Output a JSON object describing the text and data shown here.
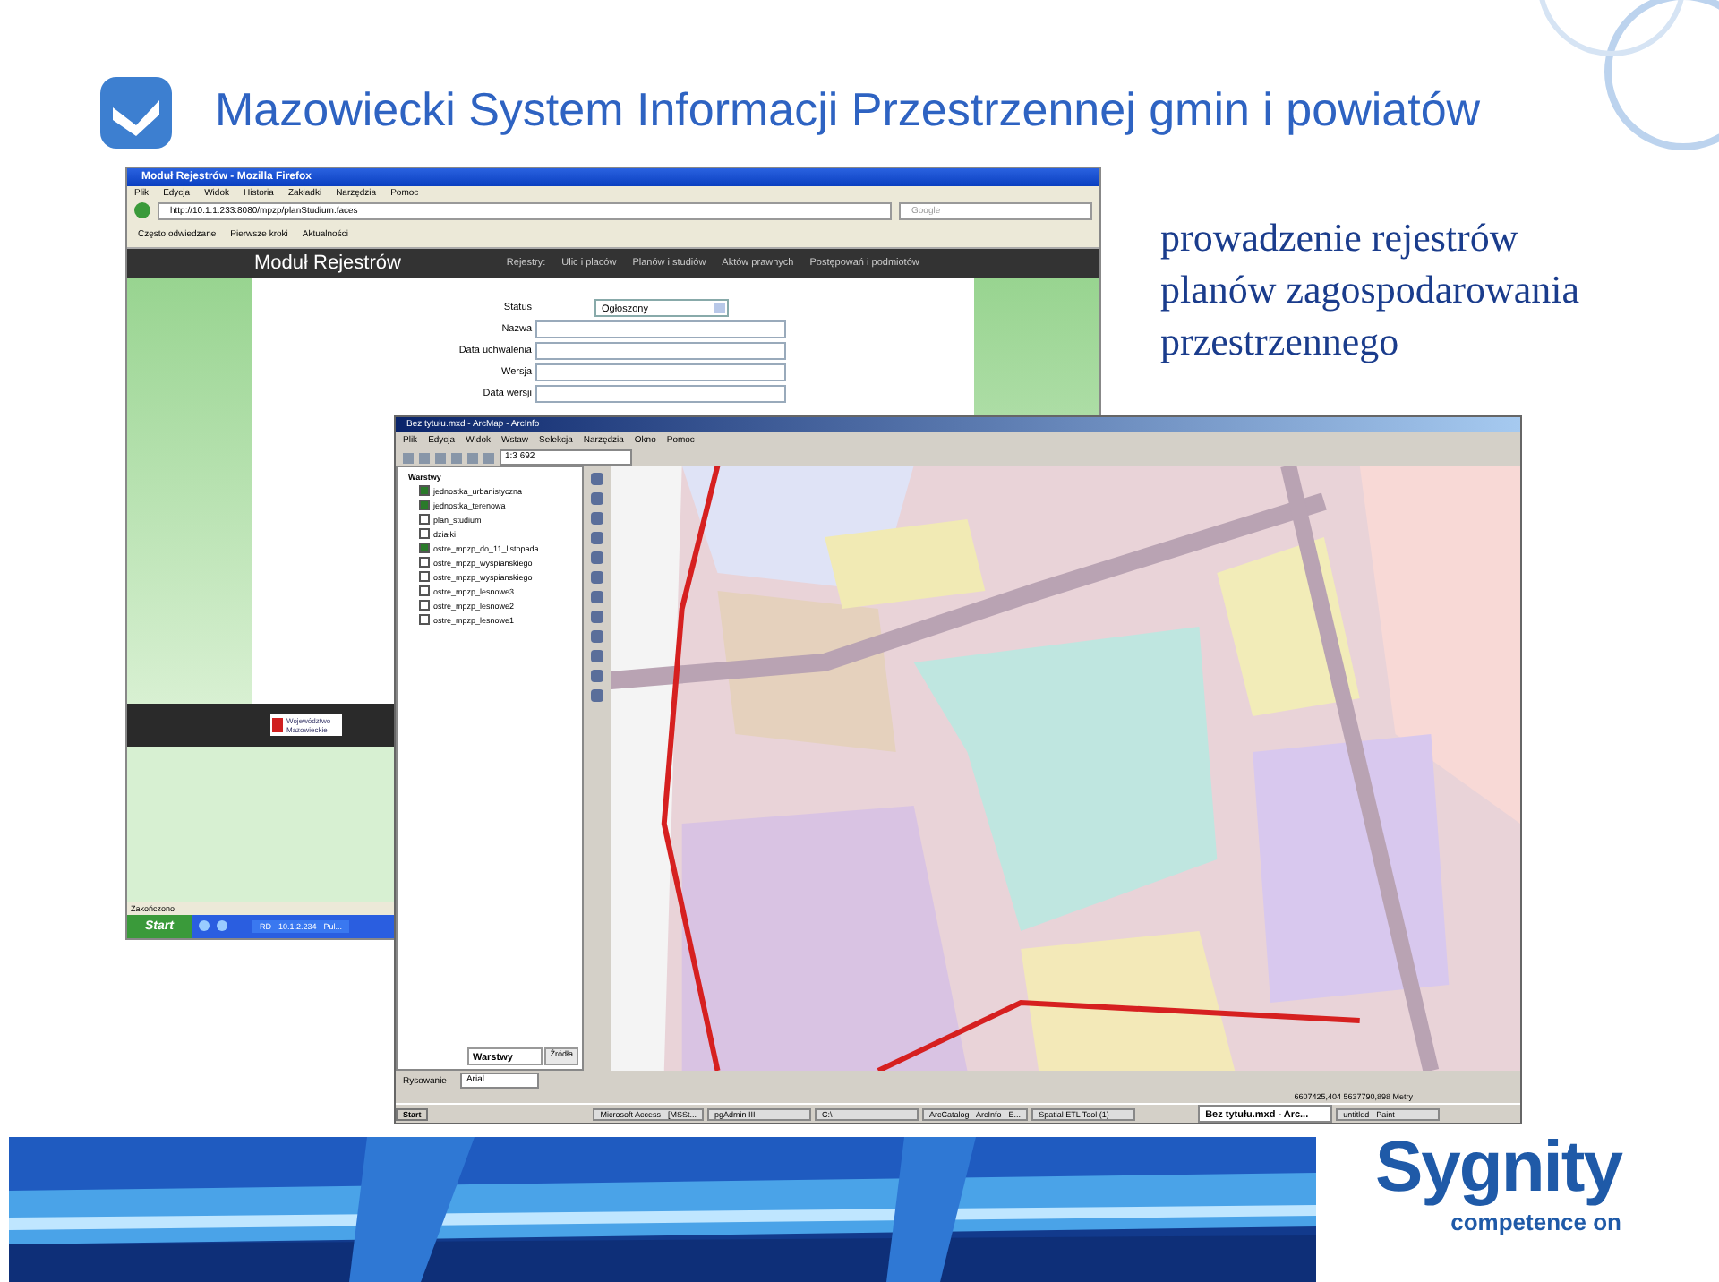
{
  "slide": {
    "title": "Mazowiecki System Informacji Przestrzennej gmin i powiatów",
    "caption_lines": [
      "prowadzenie rejestrów",
      "planów zagospodarowania",
      "przestrzennego"
    ],
    "brand": "Sygnity",
    "tagline": "competence on"
  },
  "browser": {
    "title": "Moduł Rejestrów - Mozilla Firefox",
    "menu": [
      "Plik",
      "Edycja",
      "Widok",
      "Historia",
      "Zakładki",
      "Narzędzia",
      "Pomoc"
    ],
    "url": "http://10.1.1.233:8080/mpzp/planStudium.faces",
    "search_placeholder": "Google",
    "bookmarks": [
      "Często odwiedzane",
      "Pierwsze kroki",
      "Aktualności"
    ],
    "header": {
      "brand": "Moduł Rejestrów",
      "nav_label": "Rejestry:",
      "nav": [
        "Ulic i placów",
        "Planów i studiów",
        "Aktów prawnych",
        "Postępowań i podmiotów"
      ]
    },
    "form": [
      {
        "label": "Status",
        "kind": "select",
        "value": "Ogłoszony"
      },
      {
        "label": "Nazwa",
        "kind": "text"
      },
      {
        "label": "Data uchwalenia",
        "kind": "text"
      },
      {
        "label": "Wersja",
        "kind": "text"
      },
      {
        "label": "Data wersji",
        "kind": "text"
      }
    ],
    "footer_logo": "Województwo Mazowieckie",
    "status": "Zakończono",
    "start": "Start",
    "task": "RD - 10.1.2.234 - Pul..."
  },
  "arcmap": {
    "title": "Bez tytułu.mxd - ArcMap - ArcInfo",
    "menu": [
      "Plik",
      "Edycja",
      "Widok",
      "Wstaw",
      "Selekcja",
      "Narzędzia",
      "Okno",
      "Pomoc"
    ],
    "scale": "1:3 692",
    "toc_root": "Warstwy",
    "layers": [
      {
        "name": "jednostka_urbanistyczna",
        "checked": true
      },
      {
        "name": "jednostka_terenowa",
        "checked": true
      },
      {
        "name": "plan_studium",
        "checked": false
      },
      {
        "name": "działki",
        "checked": false
      },
      {
        "name": "ostre_mpzp_do_11_listopada",
        "checked": true
      },
      {
        "name": "ostre_mpzp_wyspianskiego",
        "checked": false
      },
      {
        "name": "ostre_mpzp_wyspianskiego",
        "checked": false
      },
      {
        "name": "ostre_mpzp_lesnowe3",
        "checked": false
      },
      {
        "name": "ostre_mpzp_lesnowe2",
        "checked": false
      },
      {
        "name": "ostre_mpzp_lesnowe1",
        "checked": false
      }
    ],
    "tabs": [
      {
        "label": "Warstwy",
        "selected": true
      },
      {
        "label": "Źródła",
        "selected": false
      }
    ],
    "draw_label": "Rysowanie",
    "font": "Arial",
    "coords": "6607425,404  5637790,898 Metry",
    "start": "Start",
    "tasks": [
      {
        "label": "Microsoft Access - [MSSt...",
        "selected": false
      },
      {
        "label": "pgAdmin III",
        "selected": false
      },
      {
        "label": "C:\\",
        "selected": false
      },
      {
        "label": "ArcCatalog - ArcInfo - E...",
        "selected": false
      },
      {
        "label": "Spatial ETL Tool (1)",
        "selected": false
      },
      {
        "label": "Bez tytułu.mxd - Arc...",
        "selected": true
      },
      {
        "label": "untitled - Paint",
        "selected": false
      }
    ]
  }
}
